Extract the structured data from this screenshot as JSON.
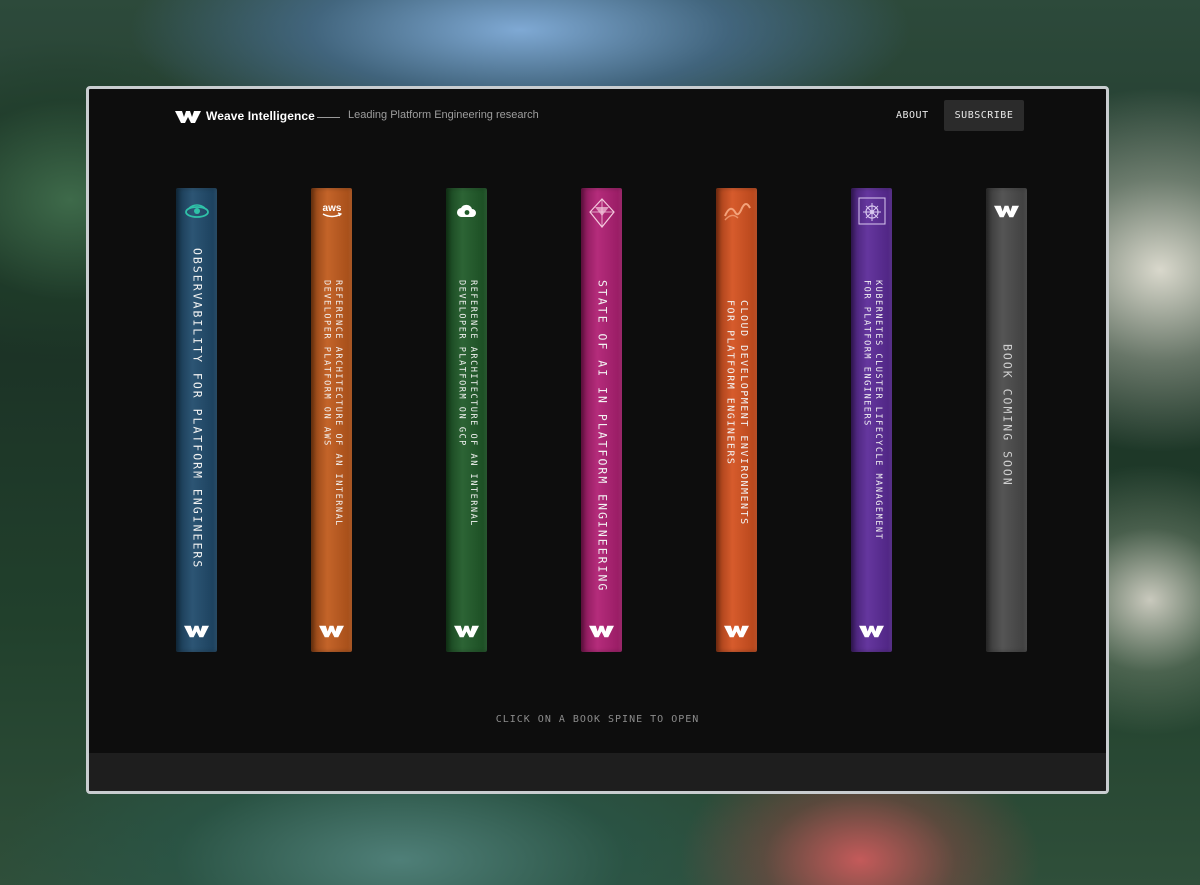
{
  "header": {
    "brand": "Weave Intelligence",
    "tagline": "Leading Platform Engineering research",
    "nav_about": "ABOUT",
    "subscribe_label": "SUBSCRIBE"
  },
  "books": [
    {
      "title": "OBSERVABILITY FOR PLATFORM ENGINEERS",
      "icon": "eye-icon",
      "color": "#1f4a6b"
    },
    {
      "title": "REFERENCE ARCHITECTURE OF AN INTERNAL\nDEVELOPER PLATFORM ON AWS",
      "icon": "aws-logo-icon",
      "icon_text": "aws",
      "color": "#c05a1c"
    },
    {
      "title": "REFERENCE ARCHITECTURE OF AN INTERNAL\nDEVELOPER PLATFORM ON GCP",
      "icon": "cloud-icon",
      "color": "#1f5a28"
    },
    {
      "title": "STATE OF AI IN PLATFORM ENGINEERING",
      "icon": "diamond-icon",
      "color": "#b01f73"
    },
    {
      "title": "CLOUD DEVELOPMENT ENVIRONMENTS\nFOR PLATFORM ENGINEERS",
      "icon": "wave-icon",
      "color": "#d4511f"
    },
    {
      "title": "KUBERNETES CLUSTER LIFECYCLE MANAGEMENT\nFOR PLATFORM ENGINEERS",
      "icon": "helm-wheel-icon",
      "color": "#5b2a98"
    },
    {
      "title": "BOOK COMING SOON",
      "icon": "weave-logo-icon",
      "color": "#4a4a4a"
    }
  ],
  "hint": "CLICK ON A BOOK SPINE TO OPEN"
}
